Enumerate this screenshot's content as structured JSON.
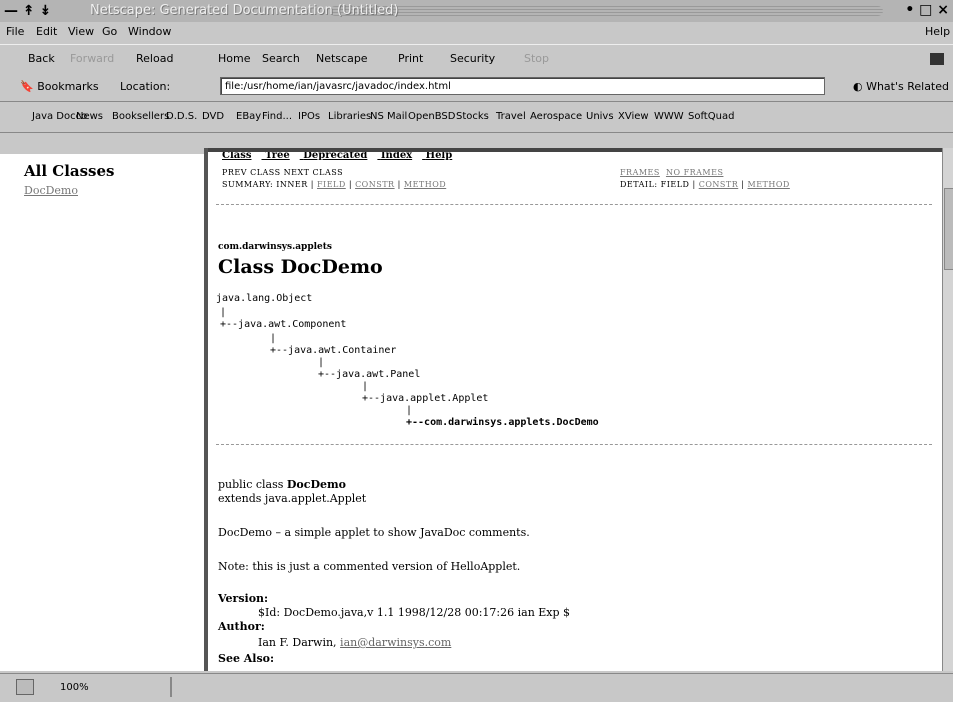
{
  "window": {
    "title": "Netscape: Generated Documentation (Untitled)",
    "controls": "• □ ×"
  },
  "menu": {
    "items": [
      "File",
      "Edit",
      "View",
      "Go",
      "Window"
    ],
    "help": "Help"
  },
  "toolbar": {
    "buttons": [
      "Back",
      "Forward",
      "Reload",
      "Home",
      "Search",
      "Netscape",
      "Print",
      "Security",
      "Stop"
    ]
  },
  "location": {
    "bookmarks_label": "Bookmarks",
    "location_label": "Location:",
    "url": "file:/usr/home/ian/javasrc/javadoc/index.html",
    "related_label": "What's Related"
  },
  "personal_toolbar": {
    "items": [
      "Java Docco",
      "News",
      "Booksellers",
      "D.D.S.",
      "DVD",
      "EBay",
      "Find...",
      "IPOs",
      "Libraries",
      "NS Mail",
      "OpenBSD",
      "Stocks",
      "Travel",
      "Aerospace",
      "Univs",
      "XView",
      "WWW",
      "SoftQuad"
    ]
  },
  "left_frame": {
    "heading": "All Classes",
    "classes": [
      "DocDemo"
    ]
  },
  "doc": {
    "top_nav": [
      "Class",
      "Tree",
      "Deprecated",
      "Index",
      "Help"
    ],
    "prev_next": "PREV CLASS   NEXT CLASS",
    "frames": "FRAMES",
    "no_frames": "NO FRAMES",
    "summary_label": "SUMMARY:  INNER | ",
    "summary_field": "FIELD",
    "summary_constr": "CONSTR",
    "summary_method": "METHOD",
    "detail_label": "DETAIL:  FIELD | ",
    "detail_constr": "CONSTR",
    "detail_method": "METHOD",
    "package": "com.darwinsys.applets",
    "class_title": "Class DocDemo",
    "tree": {
      "l0": "java.lang.Object",
      "l1": "+--java.awt.Component",
      "l2": "+--java.awt.Container",
      "l3": "+--java.awt.Panel",
      "l4": "+--java.applet.Applet",
      "l5": "+--com.darwinsys.applets.DocDemo"
    },
    "decl_prefix": "public class ",
    "decl_name": "DocDemo",
    "extends": "extends java.applet.Applet",
    "description": "DocDemo – a simple applet to show JavaDoc comments.",
    "note": "Note: this is just a commented version of HelloApplet.",
    "version_label": "Version:",
    "version_value": "$Id: DocDemo.java,v 1.1 1998/12/28 00:17:26 ian Exp $",
    "author_label": "Author:",
    "author_name": "Ian F. Darwin, ",
    "author_email": "ian@darwinsys.com",
    "see_also_label": "See Also:"
  },
  "status": {
    "zoom": "100%"
  }
}
